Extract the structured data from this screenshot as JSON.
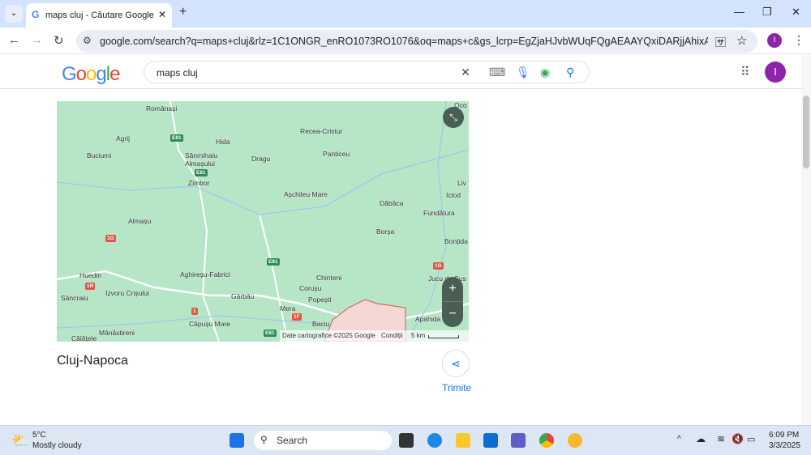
{
  "browser": {
    "tab_title": "maps cluj - Căutare Google",
    "new_tab": "+",
    "url": "google.com/search?q=maps+cluj&rlz=1C1ONGR_enRO1073RO1076&oq=maps+c&gs_lcrp=EgZjaHJvbWUqFQgAEAAYQxiDARjjAhixAxiABBiKBTIVCAAQA...",
    "profile_initial": "I"
  },
  "google": {
    "logo": "Google",
    "query": "maps cluj",
    "avatar": "I"
  },
  "map": {
    "places": [
      "Românași",
      "Agrij",
      "Hida",
      "Recea-Cristur",
      "Buciumi",
      "Sânmihaiu",
      "Almașului",
      "Dragu",
      "Panticeu",
      "Zimbor",
      "Așchileu Mare",
      "Dăbâca",
      "Iclod",
      "Fundătura",
      "Almașu",
      "Borșa",
      "Bonțida",
      "Huedin",
      "Aghireșu-Fabrici",
      "Chinteni",
      "Jucu de Sus",
      "Sâncraiu",
      "Izvoru Crișului",
      "Corușu",
      "Gârbău",
      "Popești",
      "Mera",
      "Apahida",
      "Căpușu Mare",
      "Baciu",
      "Mănăstireni",
      "Călățele",
      "Oco",
      "Liv"
    ],
    "roads": [
      "E81",
      "E81",
      "E81",
      "E81",
      "1G",
      "1G",
      "1R",
      "1",
      "1F"
    ],
    "attribution": "Date cartografice ©2025 Google",
    "terms": "Condiții",
    "scale": "5 km",
    "zoom_in": "+",
    "zoom_out": "−"
  },
  "result": {
    "title": "Cluj-Napoca",
    "share_label": "Trimite"
  },
  "taskbar": {
    "temp": "5°C",
    "weather": "Mostly cloudy",
    "search": "Search",
    "time": "6:09 PM",
    "date": "3/3/2025"
  }
}
